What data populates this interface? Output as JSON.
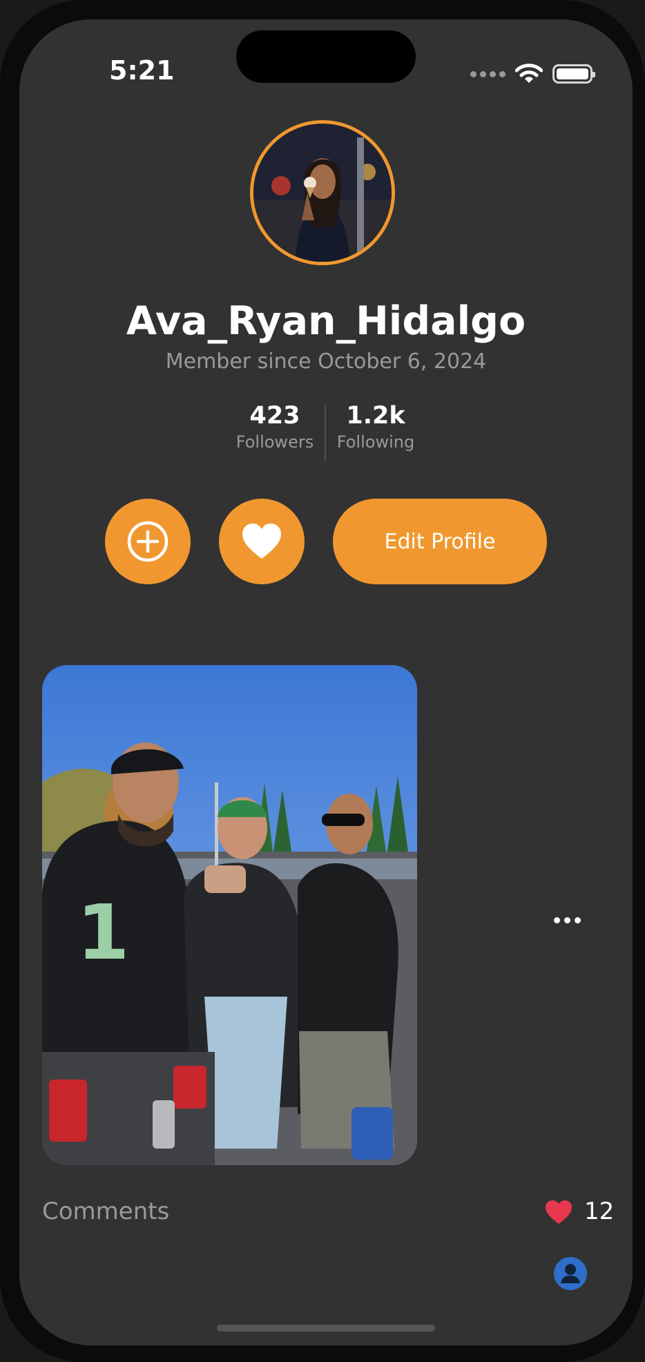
{
  "status_bar": {
    "time": "5:21"
  },
  "profile": {
    "username": "Ava_Ryan_Hidalgo",
    "member_since": "Member since October 6, 2024",
    "accent_color": "#f0982f"
  },
  "stats": {
    "followers": {
      "value": "423",
      "label": "Followers"
    },
    "following": {
      "value": "1.2k",
      "label": "Following"
    }
  },
  "actions": {
    "add_icon": "plus-circle-icon",
    "favorite_icon": "heart-icon",
    "edit_profile_label": "Edit Profile"
  },
  "post": {
    "comments_label": "Comments",
    "like_count": "12",
    "like_color": "#e8384f",
    "more_icon": "ellipsis-icon",
    "commenter_icon": "person-icon"
  }
}
